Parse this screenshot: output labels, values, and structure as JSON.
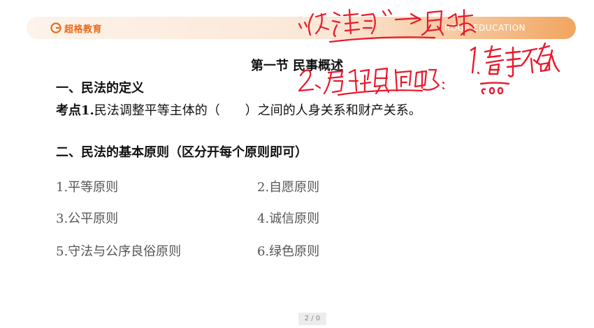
{
  "header": {
    "logo_text": "超格教育",
    "tagline": "ROGE EDUCATION"
  },
  "slide": {
    "title": "第一节 民事概述",
    "section1_heading": "一、民法的定义",
    "kaodian_label": "考点1.",
    "kaodian_text": "民法调整平等主体的（　　）之间的人身关系和财产关系。",
    "section2_heading": "二、民法的基本原则（区分开每个原则即可）",
    "principles": [
      "1.平等原则",
      "2.自愿原则",
      "3.公平原则",
      "4.诚信原则",
      "5.守法与公序良俗原则",
      "6.绿色原则"
    ]
  },
  "annotations": {
    "color": "#e8192c",
    "note1": "\"公法同\" → 职权",
    "note2": "2、属于民法典的问题：",
    "note3": "1.看事不看人",
    "note4": "600"
  },
  "pager": {
    "label": "2 / 0"
  }
}
